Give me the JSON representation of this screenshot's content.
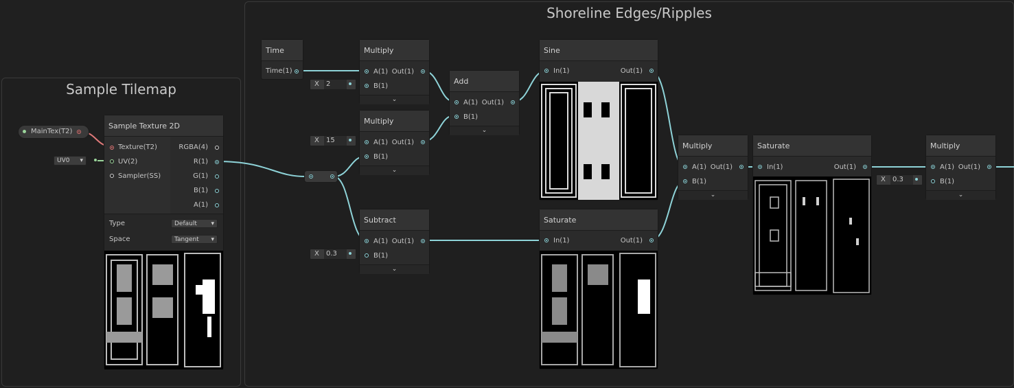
{
  "groups": {
    "tilemap": {
      "title": "Sample Tilemap"
    },
    "shoreline": {
      "title": "Shoreline Edges/Ripples"
    }
  },
  "property": {
    "label": "MainTex(T2)"
  },
  "uv": {
    "value": "UV0"
  },
  "sample_texture": {
    "title": "Sample Texture 2D",
    "inputs": [
      "Texture(T2)",
      "UV(2)",
      "Sampler(SS)"
    ],
    "outputs": [
      "RGBA(4)",
      "R(1)",
      "G(1)",
      "B(1)",
      "A(1)"
    ],
    "type_label": "Type",
    "type_value": "Default",
    "space_label": "Space",
    "space_value": "Tangent"
  },
  "time": {
    "title": "Time",
    "output": "Time(1)"
  },
  "multiply1": {
    "title": "Multiply",
    "a": "A(1)",
    "b": "B(1)",
    "out": "Out(1)",
    "b_x": "X",
    "b_value": "2"
  },
  "multiply2": {
    "title": "Multiply",
    "a": "A(1)",
    "b": "B(1)",
    "out": "Out(1)",
    "b_x": "X",
    "b_value": "15"
  },
  "add": {
    "title": "Add",
    "a": "A(1)",
    "b": "B(1)",
    "out": "Out(1)"
  },
  "subtract": {
    "title": "Subtract",
    "a": "A(1)",
    "b": "B(1)",
    "out": "Out(1)",
    "b_x": "X",
    "b_value": "0.3"
  },
  "sine": {
    "title": "Sine",
    "in": "In(1)",
    "out": "Out(1)"
  },
  "saturate1": {
    "title": "Saturate",
    "in": "In(1)",
    "out": "Out(1)"
  },
  "multiply3": {
    "title": "Multiply",
    "a": "A(1)",
    "b": "B(1)",
    "out": "Out(1)"
  },
  "saturate2": {
    "title": "Saturate",
    "in": "In(1)",
    "out": "Out(1)"
  },
  "multiply4": {
    "title": "Multiply",
    "a": "A(1)",
    "b": "B(1)",
    "out": "Out(1)",
    "b_x": "X",
    "b_value": "0.3"
  },
  "colors": {
    "wire": "#8ed3d8",
    "texture_wire": "#e07a7a",
    "uv_wire": "#9bd59b",
    "background": "#202020"
  }
}
